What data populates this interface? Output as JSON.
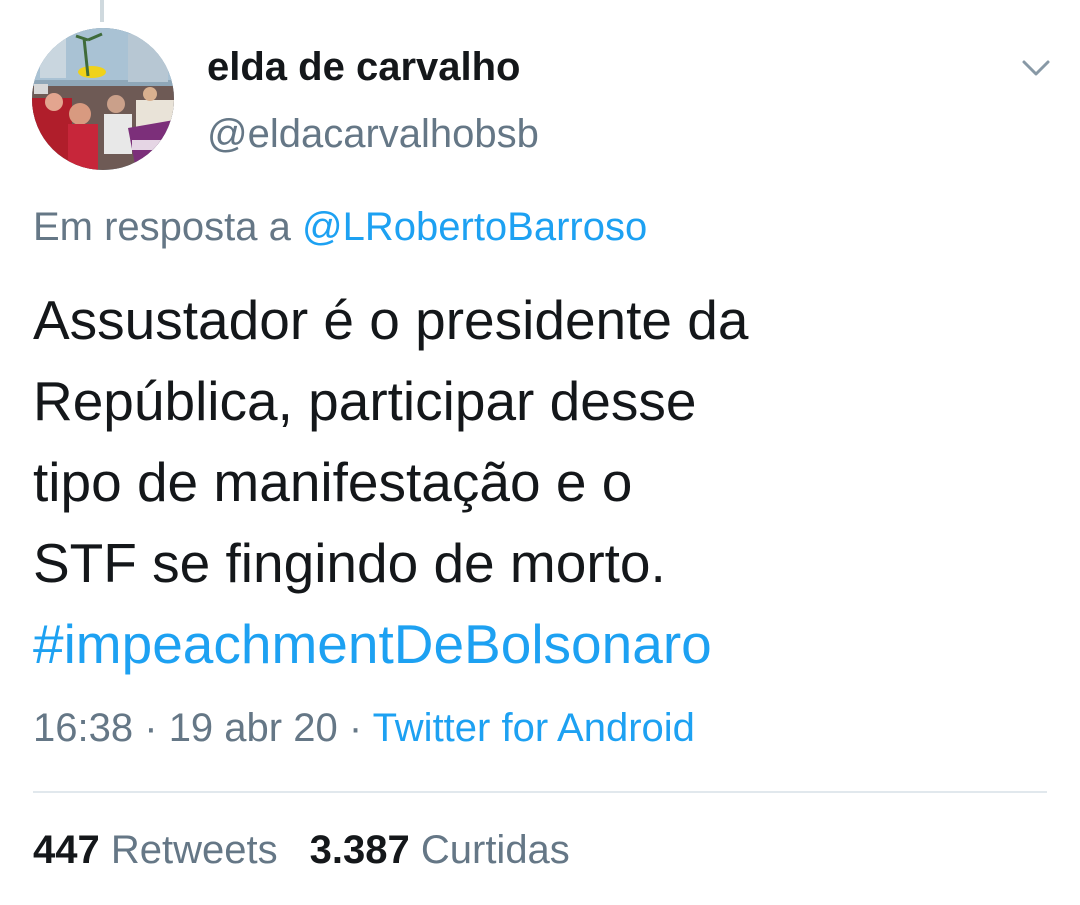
{
  "author": {
    "display_name": "elda de carvalho",
    "handle": "@eldacarvalhobsb"
  },
  "reply": {
    "prefix": "Em resposta a",
    "mention": "@LRobertoBarroso"
  },
  "tweet": {
    "lines": [
      "Assustador é o presidente da",
      "República, participar desse",
      "tipo de manifestação e o",
      "STF se fingindo de morto."
    ],
    "hashtag": "#impeachmentDeBolsonaro"
  },
  "meta": {
    "time": "16:38",
    "date": "19 abr 20",
    "separator": "·",
    "source": "Twitter for Android"
  },
  "stats": {
    "retweets_count": "447",
    "retweets_label": "Retweets",
    "likes_count": "3.387",
    "likes_label": "Curtidas"
  },
  "icons": {
    "menu": "chevron-down-icon",
    "avatar": "profile-photo"
  },
  "colors": {
    "text": "#14171a",
    "secondary": "#657786",
    "link": "#1da1f2",
    "divider": "#e1e8ed"
  }
}
